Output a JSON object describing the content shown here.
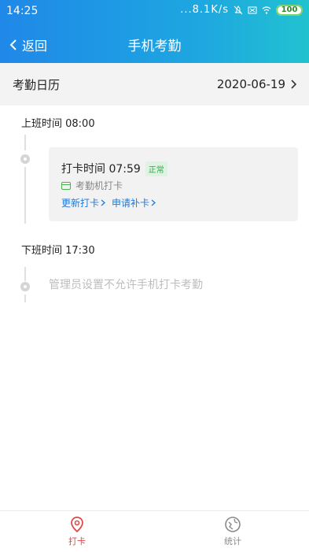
{
  "status_bar": {
    "time": "14:25",
    "network_speed": "...8.1K/s",
    "battery": "100"
  },
  "nav": {
    "back_label": "返回",
    "title": "手机考勤"
  },
  "calendar": {
    "label": "考勤日历",
    "date": "2020-06-19"
  },
  "shifts": [
    {
      "header": "上班时间 08:00",
      "punch_time": "打卡时间 07:59",
      "status_badge": "正常",
      "source": "考勤机打卡",
      "actions": [
        "更新打卡",
        "申请补卡"
      ]
    },
    {
      "header": "下班时间 17:30",
      "note": "管理员设置不允许手机打卡考勤"
    }
  ],
  "tabs": [
    {
      "label": "打卡",
      "icon": "location-pin-icon",
      "active": true
    },
    {
      "label": "统计",
      "icon": "globe-stats-icon",
      "active": false
    }
  ],
  "colors": {
    "header_gradient_start": "#1f88e8",
    "header_gradient_end": "#21c2d0",
    "link": "#1f7ad9",
    "badge_green": "#2ea84f",
    "active_tab": "#e04a4a"
  }
}
